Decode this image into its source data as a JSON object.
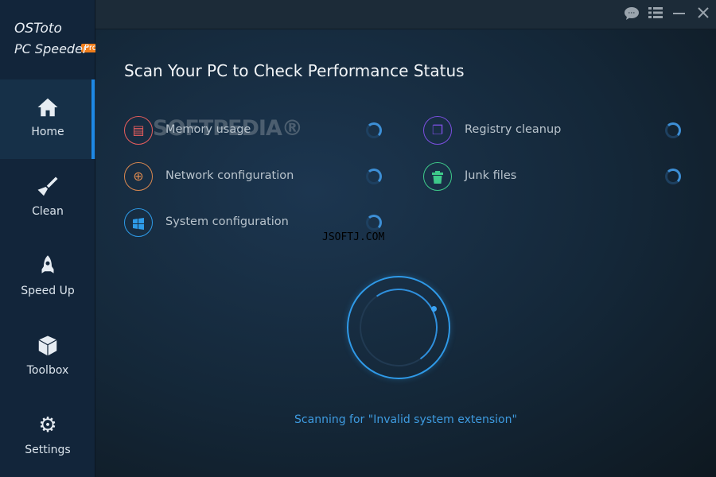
{
  "app": {
    "name": "OSToto",
    "badge": "Pro",
    "subtitle": "PC Speeder"
  },
  "sidebar": {
    "items": [
      {
        "label": "Home",
        "icon": "home-icon",
        "active": true
      },
      {
        "label": "Clean",
        "icon": "brush-icon"
      },
      {
        "label": "Speed Up",
        "icon": "rocket-icon"
      },
      {
        "label": "Toolbox",
        "icon": "box-icon"
      },
      {
        "label": "Settings",
        "icon": "gear-icon"
      }
    ]
  },
  "titlebar": {
    "icons": [
      "chat-icon",
      "menu-icon",
      "minimize-icon",
      "close-icon"
    ]
  },
  "main": {
    "title": "Scan Your PC to Check Performance Status",
    "checks": [
      {
        "label": "Memory usage",
        "icon": "floppy-icon",
        "color": "#e85d5d"
      },
      {
        "label": "Registry cleanup",
        "icon": "documents-icon",
        "color": "#7b4fe0"
      },
      {
        "label": "Network configuration",
        "icon": "network-icon",
        "color": "#d98850"
      },
      {
        "label": "Junk files",
        "icon": "trash-icon",
        "color": "#3ec98a"
      },
      {
        "label": "System configuration",
        "icon": "windows-icon",
        "color": "#2e9be8"
      }
    ],
    "status": "Scanning for \"Invalid system extension\""
  },
  "watermarks": {
    "softpedia": "SOFTPEDIA®",
    "jsoftj": "JSOFTJ.COM"
  }
}
